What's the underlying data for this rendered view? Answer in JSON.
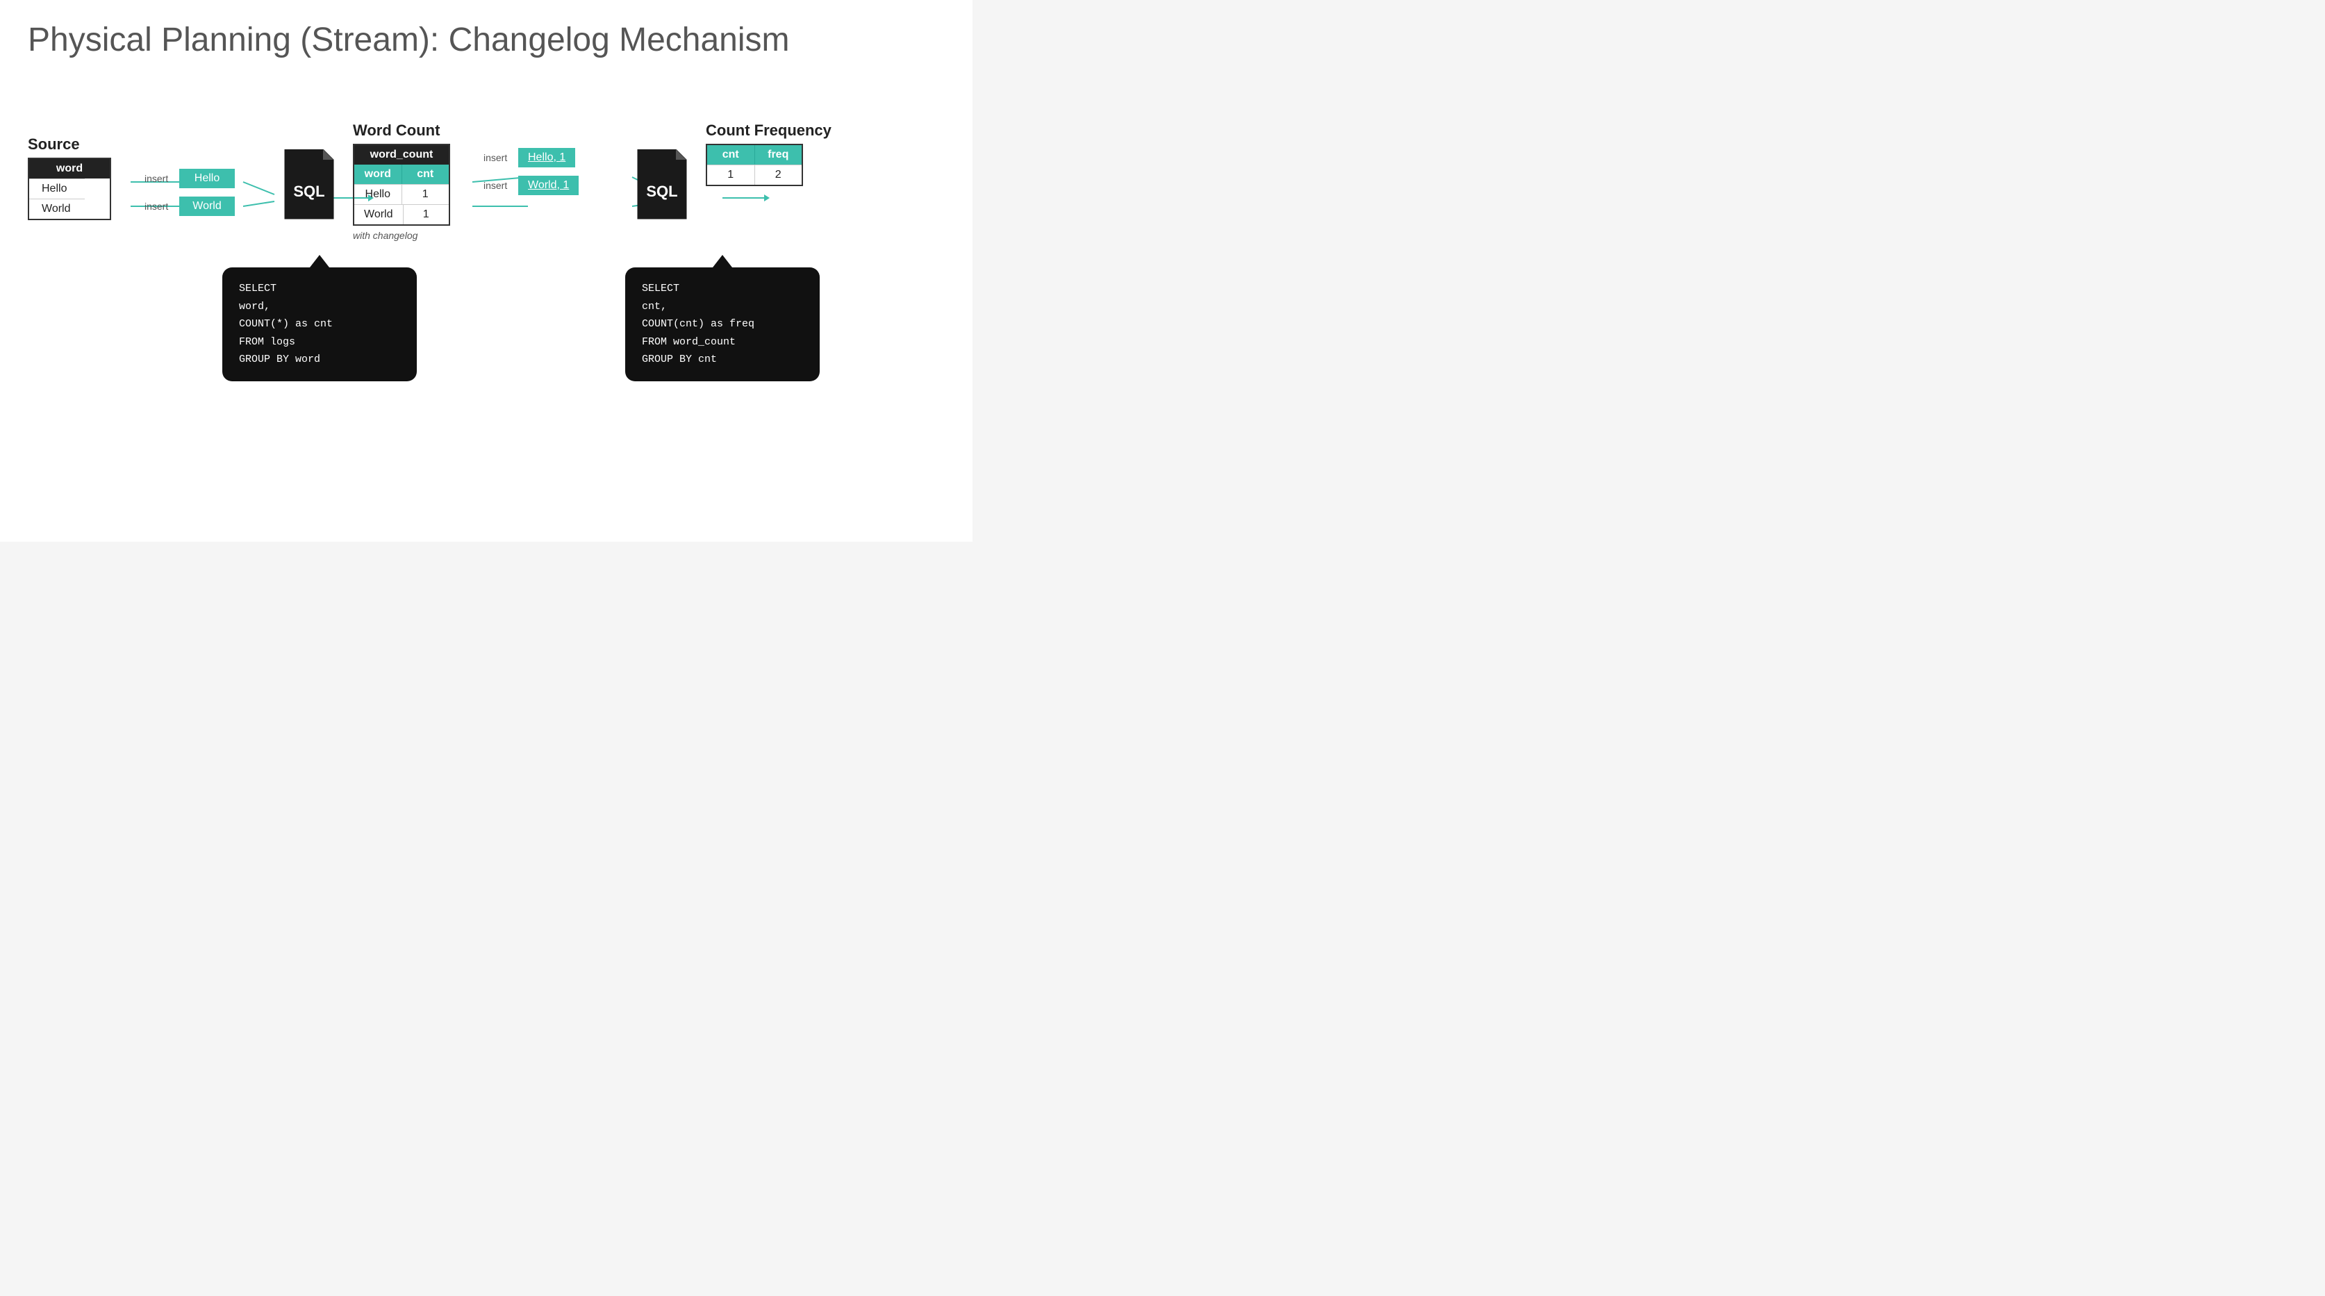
{
  "title": "Physical Planning (Stream): Changelog Mechanism",
  "source": {
    "label": "Source",
    "table": {
      "header": "word",
      "rows": [
        "Hello",
        "World"
      ]
    }
  },
  "insert_labels": [
    "insert",
    "insert"
  ],
  "insert_badges_left": [
    "Hello",
    "World"
  ],
  "sql_icon_label": "SQL",
  "word_count": {
    "label": "Word Count",
    "table": {
      "header": "word_count",
      "col1": "word",
      "col2": "cnt",
      "rows": [
        {
          "word": "Hello",
          "cnt": "1"
        },
        {
          "word": "World",
          "cnt": "1"
        }
      ]
    },
    "changelog_label": "with changelog"
  },
  "sql_bubble_left": {
    "line1": "SELECT",
    "line2": "  word,",
    "line3": "  COUNT(*) as cnt",
    "line4": "FROM logs",
    "line5": "GROUP BY word"
  },
  "insert_badges_right": [
    "Hello, 1",
    "World, 1"
  ],
  "count_frequency": {
    "label": "Count Frequency",
    "table": {
      "col1": "cnt",
      "col2": "freq",
      "rows": [
        {
          "cnt": "1",
          "freq": "2"
        }
      ]
    }
  },
  "sql_bubble_right": {
    "line1": "SELECT",
    "line2": "  cnt,",
    "line3": "  COUNT(cnt) as freq",
    "line4": "FROM word_count",
    "line5": "GROUP BY cnt"
  }
}
